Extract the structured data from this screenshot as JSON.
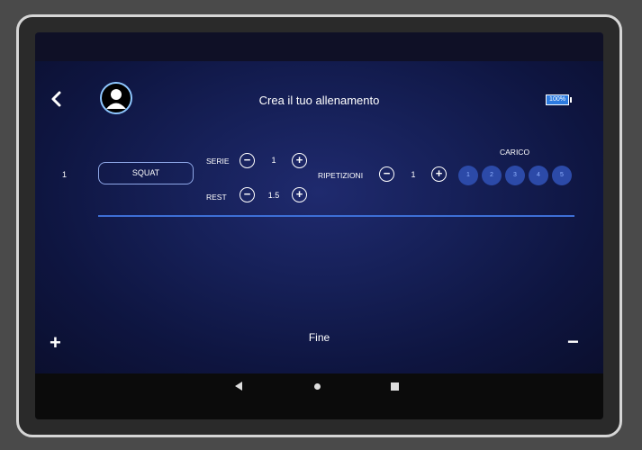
{
  "header": {
    "title": "Crea il tuo allenamento",
    "battery": "100%"
  },
  "exercise_row": {
    "number": "1",
    "exercise_name": "SQUAT",
    "serie_label": "SERIE",
    "serie_value": "1",
    "rest_label": "REST",
    "rest_value": "1.5",
    "ripetizioni_label": "RIPETIZIONI",
    "ripetizioni_value": "1",
    "carico_label": "CARICO",
    "carico_options": [
      "1",
      "2",
      "3",
      "4",
      "5"
    ]
  },
  "footer": {
    "add_symbol": "+",
    "finish_label": "Fine",
    "remove_symbol": "−"
  },
  "colors": {
    "accent": "#3d6fd6",
    "load_button": "#2c4aa8",
    "battery": "#2d7be0"
  },
  "icons": {
    "back": "back-arrow-icon",
    "avatar": "user-avatar-icon",
    "nav_back": "triangle-left-icon",
    "nav_home": "circle-icon",
    "nav_recent": "square-icon"
  }
}
